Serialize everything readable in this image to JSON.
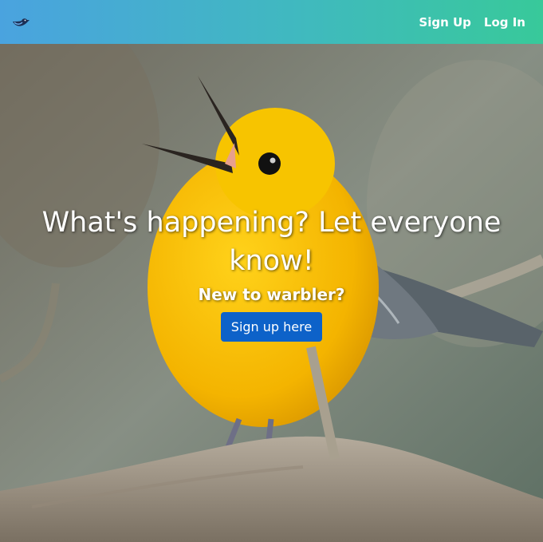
{
  "navbar": {
    "logo_icon": "bird-icon",
    "links": [
      "Sign Up",
      "Log In"
    ]
  },
  "hero": {
    "title": "What's happening? Let everyone know!",
    "subtitle": "New to warbler?",
    "cta_label": "Sign up here"
  },
  "colors": {
    "nav_gradient_start": "#4aa3df",
    "nav_gradient_end": "#38c99a",
    "button": "#0d62c9"
  }
}
